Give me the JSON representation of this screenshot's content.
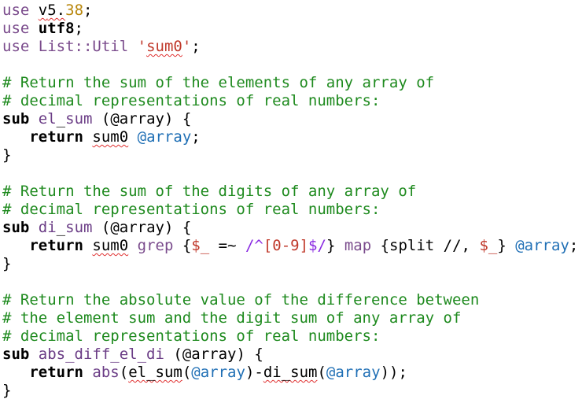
{
  "code": {
    "l1": {
      "use": "use",
      "v1": "v",
      "v2": "5.",
      "v3": "38",
      "semi": ";"
    },
    "l2": {
      "use": "use",
      "mod": "utf8",
      "semi": ";"
    },
    "l3": {
      "use": "use",
      "mod": "List::Util",
      "q1": "'",
      "fn": "sum0",
      "q2": "'",
      "semi": ";"
    },
    "c1": "# Return the sum of the elements of any array of",
    "c2": "# decimal representations of real numbers:",
    "sub1": {
      "kw": "sub",
      "sp": " ",
      "name1": "el",
      "us": "_",
      "name2": "sum",
      "rest": " (@array) {"
    },
    "ret1": {
      "indent": "   ",
      "kw": "return",
      "sp": " ",
      "fn": "sum0",
      "sp2": " ",
      "var": "@array",
      "semi": ";"
    },
    "close1": "}",
    "c3": "# Return the sum of the digits of any array of",
    "c4": "# decimal representations of real numbers:",
    "sub2": {
      "kw": "sub",
      "sp": " ",
      "name1": "di",
      "us": "_",
      "name2": "sum",
      "rest": " (@array) {"
    },
    "ret2": {
      "indent": "   ",
      "kw": "return",
      "sp": " ",
      "fn": "sum0",
      "sp2": " ",
      "grep": "grep",
      "brace": " {",
      "var1": "$_",
      "op": " =~ ",
      "rx1": "/^",
      "cls": "[0-9]",
      "rx2": "$/",
      "brace2": "} ",
      "map": "map",
      "split": " {split //, ",
      "var2": "$_",
      "brace3": "} ",
      "var3": "@array",
      "semi": ";"
    },
    "close2": "}",
    "c5": "# Return the absolute value of the difference between",
    "c6": "# the element sum and the digit sum of any array of",
    "c7": "# decimal representations of real numbers:",
    "sub3": {
      "kw": "sub",
      "sp": " ",
      "name": "abs_diff_el_di",
      "rest": " (@array) {"
    },
    "ret3": {
      "indent": "   ",
      "kw": "return",
      "sp": " ",
      "abs": "abs",
      "p1": "(",
      "f1": "el_sum",
      "p2": "(",
      "var1": "@array",
      "p3": ")-",
      "f2": "di_sum",
      "p4": "(",
      "var2": "@array",
      "p5": "));"
    },
    "close3": "}"
  }
}
